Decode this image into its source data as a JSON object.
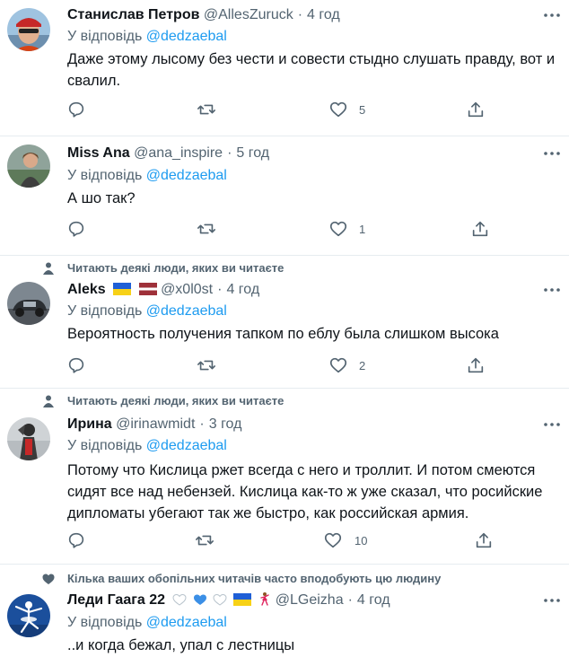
{
  "colors": {
    "accent": "#1d9bf0",
    "secondary_text": "#536471",
    "divider": "#e6ecf0"
  },
  "replying_prefix": "У відповідь",
  "tweets": [
    {
      "name": "Станислав Петров",
      "handle": "@AllesZuruck",
      "dot": "·",
      "time": "4 год",
      "mention": "@dedzaebal",
      "text": "Даже этому лысому без чести и совести стыдно слушать правду, вот и свалил.",
      "likes": "5",
      "avatar": "man-red-cap-avatar"
    },
    {
      "name": "Miss Ana",
      "handle": "@ana_inspire",
      "dot": "·",
      "time": "5 год",
      "mention": "@dedzaebal",
      "text": "А шо так?",
      "likes": "1",
      "avatar": "woman-outdoor-avatar"
    },
    {
      "social": "Читають деякі люди, яких ви читаєте",
      "social_icon": "person-icon",
      "name": "Aleks",
      "flags": [
        "flag-ukraine-icon",
        "flag-latvia-icon"
      ],
      "handle": "@x0l0st",
      "dot": "·",
      "time": "4 год",
      "mention": "@dedzaebal",
      "text": "Вероятность получения тапком по еблу была слишком высока",
      "likes": "2",
      "avatar": "car-photo-avatar"
    },
    {
      "social": "Читають деякі люди, яких ви читаєте",
      "social_icon": "person-icon",
      "name": "Ирина",
      "handle": "@irinawmidt",
      "dot": "·",
      "time": "3 год",
      "mention": "@dedzaebal",
      "text": "Потому что Кислица ржет всегда с него и троллит. И потом смеются сидят все над небензей. Кислица как-то ж уже сказал, что росийские дипломаты убегают так же быстро, как российская армия.",
      "likes": "10",
      "avatar": "costume-figure-avatar"
    },
    {
      "social": "Кілька ваших обопільних читачів часто вподобують цю людину",
      "social_icon": "heart-icon",
      "name": "Леди Гаага 22",
      "emojis": [
        "white-heart-icon",
        "blue-heart-icon",
        "white-heart-icon",
        "flag-ukraine-icon",
        "dancer-icon"
      ],
      "handle": "@LGeizha",
      "dot": "·",
      "time": "4 год",
      "mention": "@dedzaebal",
      "text": "..и когда бежал, упал с лестницы",
      "avatar": "ballerina-avatar"
    }
  ]
}
